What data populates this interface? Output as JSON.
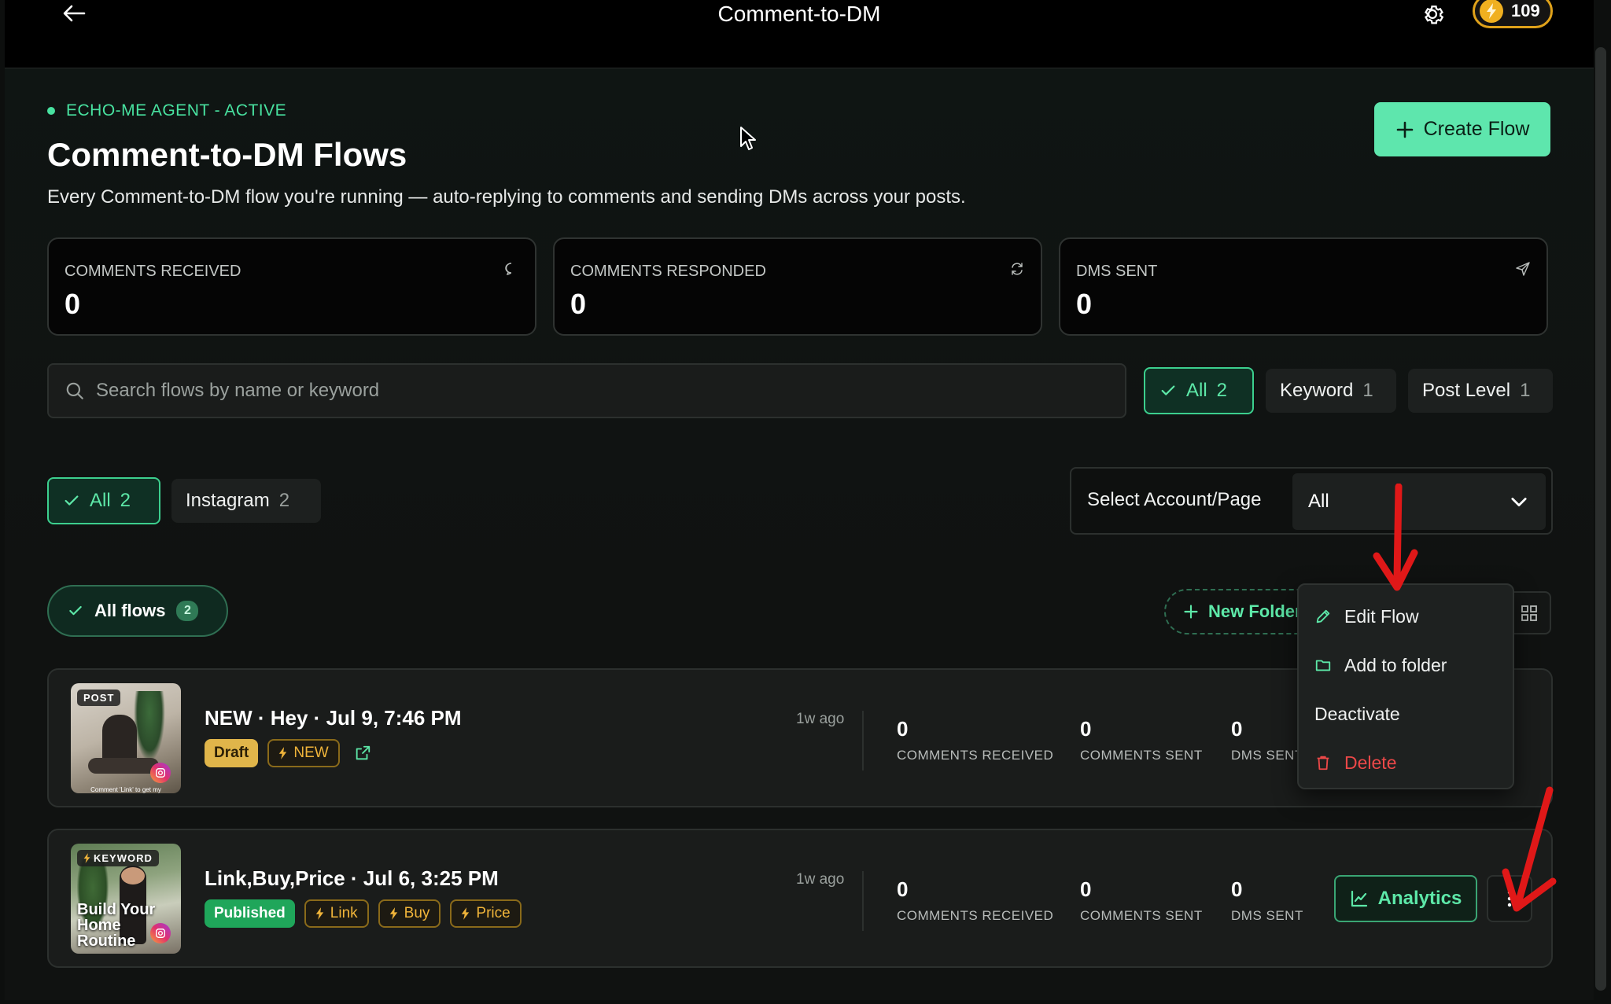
{
  "header": {
    "title": "Comment-to-DM",
    "credits": "109"
  },
  "page": {
    "agent_status": "ECHO-ME AGENT - ACTIVE",
    "title": "Comment-to-DM Flows",
    "subtitle": "Every Comment-to-DM flow you're running — auto-replying to comments and sending DMs across your posts.",
    "create_button": "Create Flow"
  },
  "stats": [
    {
      "label": "COMMENTS RECEIVED",
      "value": "0",
      "icon": "chat-bubble-icon"
    },
    {
      "label": "COMMENTS RESPONDED",
      "value": "0",
      "icon": "refresh-icon"
    },
    {
      "label": "DMS SENT",
      "value": "0",
      "icon": "send-icon"
    }
  ],
  "search": {
    "placeholder": "Search flows by name or keyword"
  },
  "type_filters": [
    {
      "label": "All",
      "count": "2",
      "active": true
    },
    {
      "label": "Keyword",
      "count": "1",
      "active": false
    },
    {
      "label": "Post Level",
      "count": "1",
      "active": false
    }
  ],
  "platform_filters": [
    {
      "label": "All",
      "count": "2",
      "active": true
    },
    {
      "label": "Instagram",
      "count": "2",
      "active": false
    }
  ],
  "account_select": {
    "label": "Select Account/Page",
    "value": "All"
  },
  "folders": {
    "all_flows_label": "All flows",
    "all_flows_count": "2",
    "new_folder_label": "New Folder"
  },
  "flows": [
    {
      "thumb_tag": "POST",
      "thumb_caption": "Comment 'Link' to get my",
      "name": "NEW · Hey · Jul 9, 7:46 PM",
      "status": "Draft",
      "keywords": [
        "NEW"
      ],
      "time_ago": "1w ago",
      "metrics": [
        {
          "value": "0",
          "label": "COMMENTS RECEIVED"
        },
        {
          "value": "0",
          "label": "COMMENTS SENT"
        },
        {
          "value": "0",
          "label": "DMS SENT"
        }
      ]
    },
    {
      "thumb_tag": "KEYWORD",
      "thumb_caption": "Build Your Home Routine",
      "name": "Link,Buy,Price · Jul 6, 3:25 PM",
      "status": "Published",
      "keywords": [
        "Link",
        "Buy",
        "Price"
      ],
      "time_ago": "1w ago",
      "metrics": [
        {
          "value": "0",
          "label": "COMMENTS RECEIVED"
        },
        {
          "value": "0",
          "label": "COMMENTS SENT"
        },
        {
          "value": "0",
          "label": "DMS SENT"
        }
      ],
      "analytics_label": "Analytics"
    }
  ],
  "context_menu": {
    "items": [
      {
        "label": "Edit Flow",
        "icon": "pencil-icon"
      },
      {
        "label": "Add to folder",
        "icon": "folder-icon"
      },
      {
        "label": "Deactivate",
        "icon": ""
      },
      {
        "label": "Delete",
        "icon": "trash-icon"
      }
    ]
  },
  "colors": {
    "accent": "#5ee6ad",
    "danger": "#ec4848",
    "keyword": "#f0b43a",
    "draft": "#e0b54a",
    "published": "#1fa65a",
    "annotation_arrow": "#e01818"
  }
}
